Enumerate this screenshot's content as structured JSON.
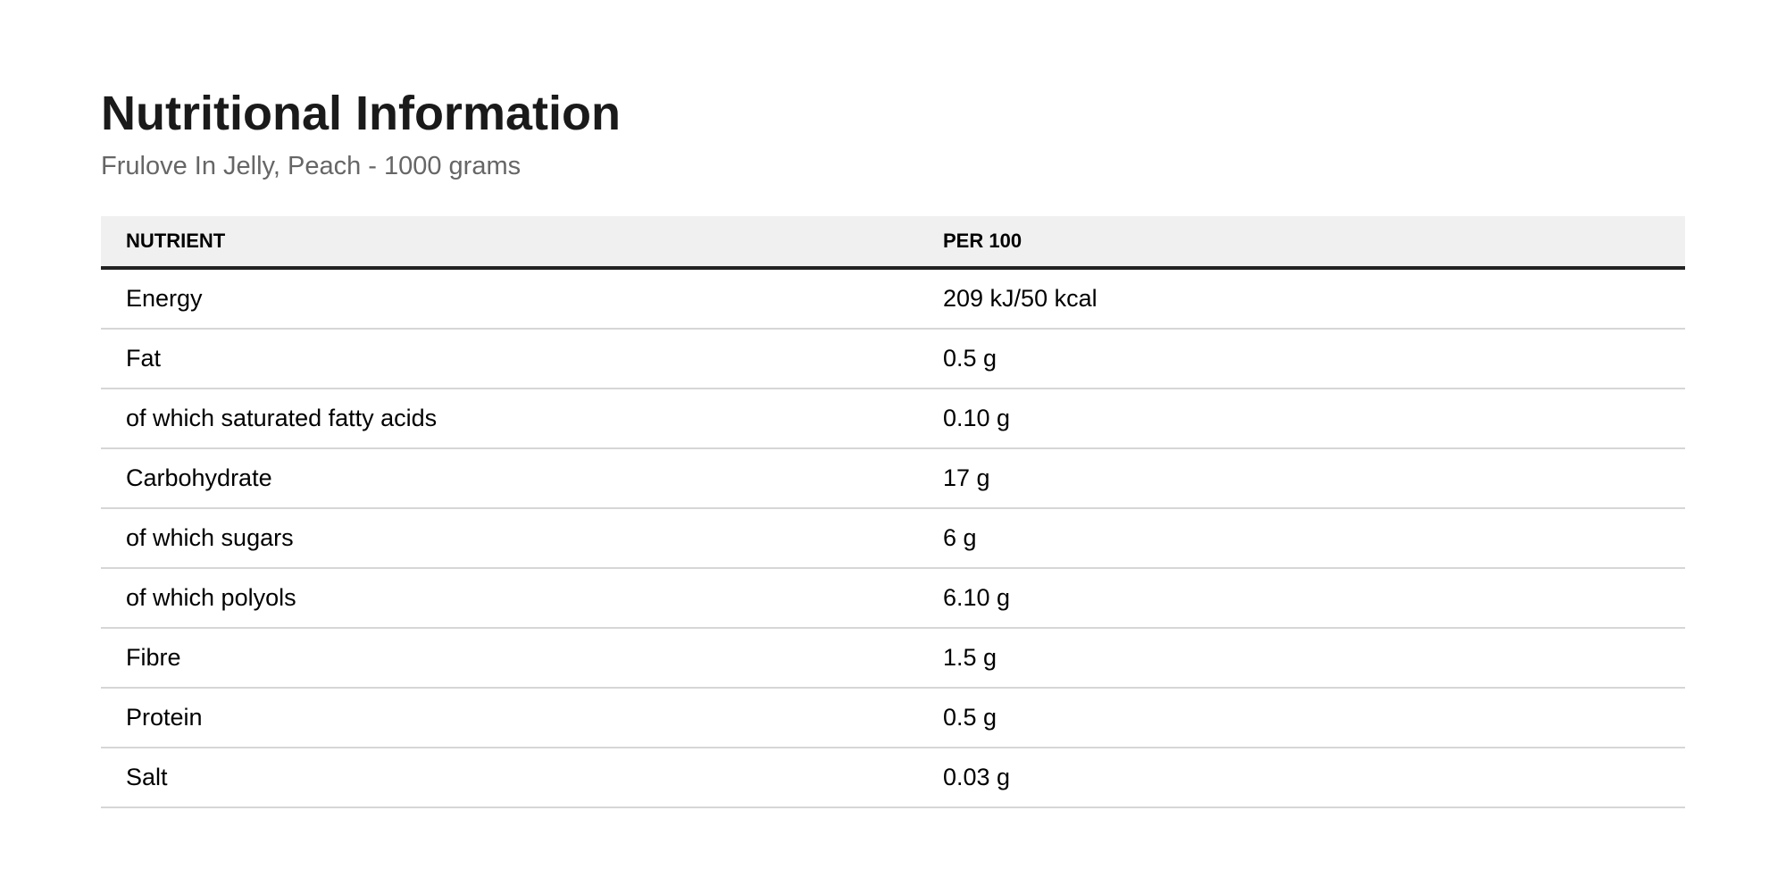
{
  "header": {
    "title": "Nutritional Information",
    "subtitle": "Frulove In Jelly, Peach - 1000 grams"
  },
  "table": {
    "columns": [
      "NUTRIENT",
      "PER 100"
    ],
    "rows": [
      [
        "Energy",
        "209 kJ/50 kcal"
      ],
      [
        "Fat",
        "0.5 g"
      ],
      [
        "of which saturated fatty acids",
        "0.10 g"
      ],
      [
        "Carbohydrate",
        "17 g"
      ],
      [
        "of which sugars",
        "6 g"
      ],
      [
        "of which polyols",
        "6.10 g"
      ],
      [
        "Fibre",
        "1.5 g"
      ],
      [
        "Protein",
        "0.5 g"
      ],
      [
        "Salt",
        "0.03 g"
      ]
    ]
  },
  "colors": {
    "text": "#1a1a1a",
    "subtitle": "#666666",
    "header_bg": "#f0f0f0",
    "header_rule": "#222222",
    "row_rule": "#d6d6d6"
  }
}
